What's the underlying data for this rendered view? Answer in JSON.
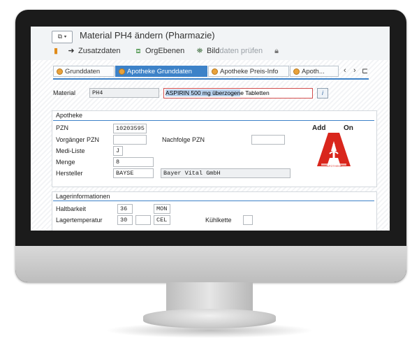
{
  "window": {
    "title": "Material PH4 ändern (Pharmazie)"
  },
  "toolbar": {
    "zusatzdaten": "Zusatzdaten",
    "orgebenen": "OrgEbenen",
    "bilddaten_a": "Bild",
    "bilddaten_b": "daten prüfen"
  },
  "tabs": [
    {
      "label": "Grunddaten",
      "active": false
    },
    {
      "label": "Apotheke Grunddaten",
      "active": true
    },
    {
      "label": "Apotheke Preis-Info",
      "active": false
    },
    {
      "label": "Apoth...",
      "active": false
    }
  ],
  "material": {
    "label": "Material",
    "value": "PH4",
    "description_selected": "ASPIRIN 500 mg überzogen",
    "description_rest": "e Tabletten"
  },
  "apotheke": {
    "title": "Apotheke",
    "pzn_label": "PZN",
    "pzn_value": "10203595",
    "vorgaenger_label": "Vorgänger PZN",
    "vorgaenger_value": "",
    "nachfolge_label": "Nachfolge PZN",
    "nachfolge_value": "",
    "medi_label": "Medi-Liste",
    "medi_value": "J",
    "menge_label": "Menge",
    "menge_value": "8",
    "hersteller_label": "Hersteller",
    "hersteller_code": "BAYSE",
    "hersteller_name": "Bayer Vital GmbH"
  },
  "addon": {
    "add": "Add",
    "on": "On",
    "logo_text": "APOTHEKE"
  },
  "lager": {
    "title": "Lagerinformationen",
    "haltbarkeit_label": "Haltbarkeit",
    "haltbarkeit_value": "36",
    "haltbarkeit_unit": "MON",
    "temp_label": "Lagertemperatur",
    "temp_value": "30",
    "temp_extra": "",
    "temp_unit": "CEL",
    "kuehlkette_label": "Kühlkette",
    "kuehlkette_value": ""
  },
  "colors": {
    "accent": "#3d82c8",
    "logo_red": "#d9261c"
  }
}
